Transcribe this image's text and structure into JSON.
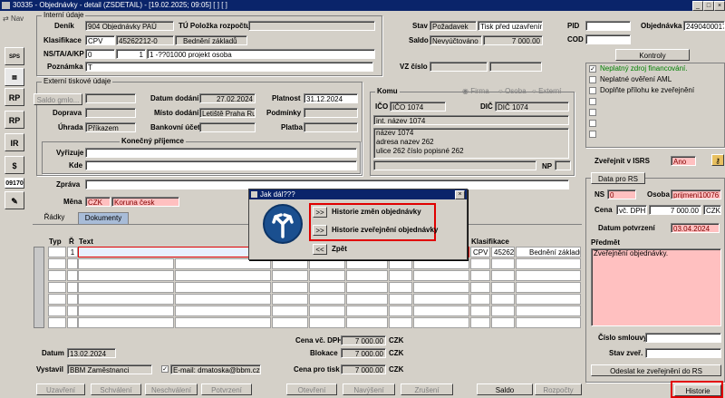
{
  "window": {
    "title": "30335 - Objednávky - detail (ZSDETAIL) - [19.02.2025; 09:05]  [ ]  [ ]"
  },
  "sidebar": {
    "nav_label": "Nav",
    "items": [
      "SPS",
      "RP",
      "RP",
      "IR",
      "$",
      "09170",
      "✎"
    ]
  },
  "interni": {
    "group_label": "Interní údaje",
    "denik_label": "Deník",
    "denik_value": "904 Objednávky PAÚ",
    "tu_label": "TÚ Položka rozpočtu",
    "tu_value": "",
    "klasifikace_label": "Klasifikace",
    "klas1": "CPV",
    "klas2": "45262212-0",
    "klas3": "Bednění základů",
    "ns_label": "NS/TA/A/KP",
    "ns1": "0",
    "ns2": "1",
    "ns3": "1 -??01000 projekt osoba",
    "poznamka_label": "Poznámka",
    "poznamka_value": "T"
  },
  "stav": {
    "stav_label": "Stav",
    "stav1": "Požadavek",
    "stav2": "Tisk před uzavřením",
    "saldo_label": "Saldo",
    "saldo1": "Nevyúčtováno",
    "saldo2": "7 000.00",
    "vz_label": "VZ číslo"
  },
  "right_top": {
    "pid_label": "PID",
    "cod_label": "COD",
    "objednavka_label": "Objednávka",
    "objednavka_value": "2490400017"
  },
  "kontroly": {
    "button": "Kontroly",
    "items": [
      {
        "checked": true,
        "text": "Neplatný zdroj financování.",
        "color": "#008000"
      },
      {
        "checked": false,
        "text": "Neplatné ověření AML",
        "color": "#000000"
      },
      {
        "checked": false,
        "text": "Doplňte přílohu ke zveřejnění",
        "color": "#000000"
      }
    ]
  },
  "externi": {
    "group_label": "Externí tiskové údaje",
    "saldo_btn": "Saldo gmlo...",
    "doprava_label": "Doprava",
    "uhrada_label": "Úhrada",
    "uhrada_value": "Příkazem",
    "datum_dodani_label": "Datum dodání",
    "datum_dodani_value": "27.02.2024",
    "misto_label": "Místo dodání",
    "misto_value": "Letiště Praha Ru",
    "bank_label": "Bankovní účet",
    "platnost_label": "Platnost",
    "platnost_value": "31.12.2024",
    "podminky_label": "Podmínky",
    "platba_label": "Platba",
    "konecny_label": "Konečný příjemce",
    "vyrizuje_label": "Vyřizuje",
    "kde_label": "Kde",
    "zprava_label": "Zpráva",
    "mena_label": "Měna",
    "mena1": "CZK",
    "mena2": "Koruna česk"
  },
  "komu": {
    "label": "Komu",
    "radio1": "Firma",
    "radio2": "Osoba",
    "radio3": "Externí",
    "ico_label": "IČO",
    "ico_value": "IČO 1074",
    "dic_label": "DIČ",
    "dic_value": "DIČ 1074",
    "name_field": "int. název 1074",
    "addr": [
      "název 1074",
      "adresa nazev 262",
      "ulice 262 číslo popisné 262"
    ],
    "np_label": "NP"
  },
  "isrs": {
    "zverejnit_label": "Zveřejnit v ISRS",
    "zverejnit_value": "Ano",
    "data_btn": "Data pro RS",
    "ns_label": "NS",
    "ns_value": "0",
    "osoba_label": "Osoba",
    "osoba_value": "prijmeni10076",
    "cena_label": "Cena",
    "cena_type": "vč. DPH",
    "cena_value": "7 000.00",
    "cena_cur": "CZK",
    "datum_label": "Datum potvrzení",
    "datum_value": "03.04.2024",
    "predmet_label": "Předmět",
    "predmet_value": "Zveřejnění objednávky.",
    "cislo_label": "Číslo smlouvy",
    "stav_label": "Stav zveř.",
    "odeslat_btn": "Odeslat ke zveřejnění do RS"
  },
  "tabs": [
    "Řádky",
    "Dokumenty"
  ],
  "grid": {
    "headers": [
      "Typ",
      "Ř",
      "Text"
    ],
    "row1_num": "1",
    "klas_header": "Klasifikace",
    "klas_row": [
      "CPV",
      "45262",
      "Bednění základů"
    ]
  },
  "dialog": {
    "title": "Jak dál???",
    "opt1": "Historie změn objednávky",
    "opt2": "Historie zveřejnění objednávky",
    "back": "Zpět",
    "btn": ">>",
    "back_btn": "<<"
  },
  "totals": {
    "cena_dph_label": "Cena vč. DPH",
    "cena_dph_value": "7 000.00",
    "blokace_label": "Blokace",
    "blokace_value": "7 000.00",
    "cena_tisk_label": "Cena pro tisk",
    "cena_tisk_value": "7 000.00",
    "cur": "CZK"
  },
  "footer": {
    "datum_label": "Datum",
    "datum_value": "13.02.2024",
    "vystavil_label": "Vystavil",
    "vystavil_value": "BBM Zaměstnanci",
    "email": "E-mail: dmatoska@bbm.cz"
  },
  "buttons": [
    "Uzavření",
    "Schválení",
    "Neschválení",
    "Potvrzení",
    "Otevření",
    "Navýšení",
    "Zrušení",
    "Saldo",
    "Rozpočty",
    "Historie"
  ]
}
